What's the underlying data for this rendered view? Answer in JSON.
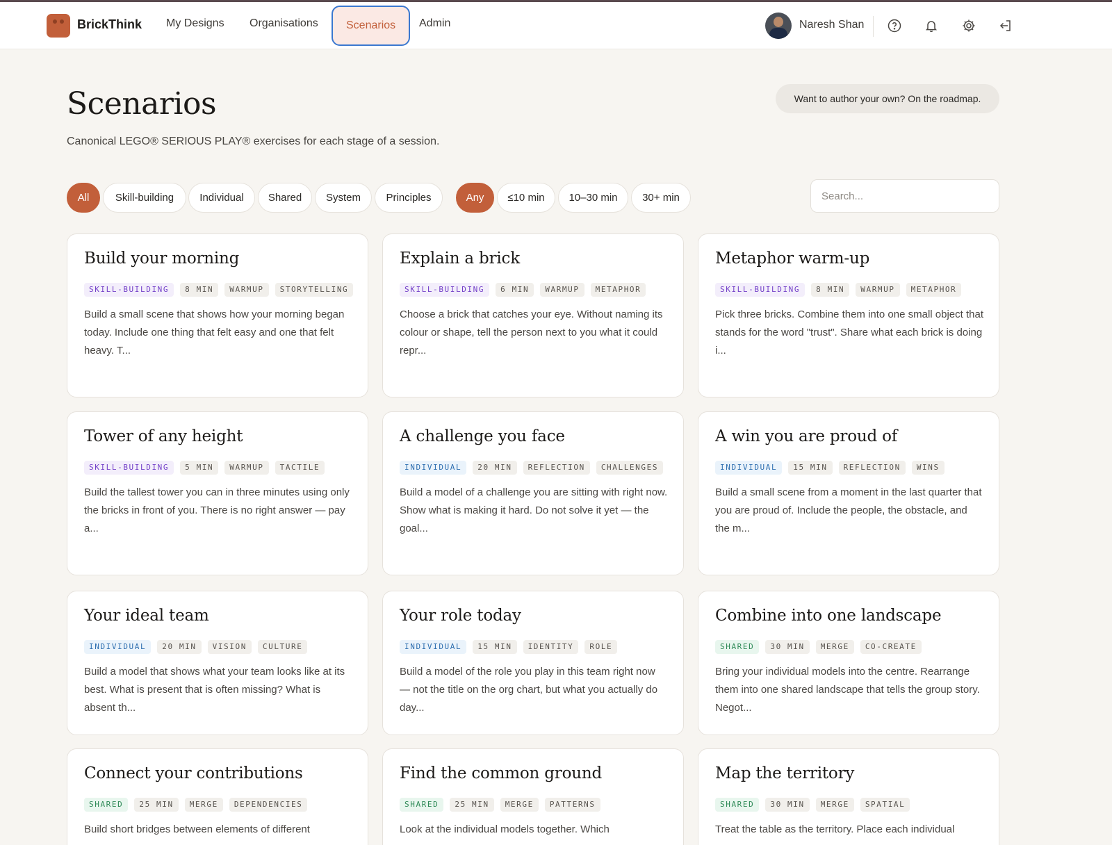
{
  "app": {
    "brand": "BrickThink"
  },
  "nav": [
    {
      "label": "My Designs",
      "active": false
    },
    {
      "label": "Organisations",
      "active": false
    },
    {
      "label": "Scenarios",
      "active": true
    },
    {
      "label": "Admin",
      "active": false
    }
  ],
  "user": {
    "name": "Naresh Shan"
  },
  "header_icons": [
    "help-icon",
    "bell-icon",
    "gear-icon",
    "logout-icon"
  ],
  "page": {
    "title": "Scenarios",
    "subtitle": "Canonical LEGO® SERIOUS PLAY® exercises for each stage of a session.",
    "roadmap_pill": "Want to author your own? On the roadmap."
  },
  "filters": {
    "categories": [
      "All",
      "Skill-building",
      "Individual",
      "Shared",
      "System",
      "Principles"
    ],
    "category_selected": "All",
    "durations": [
      "Any",
      "≤10 min",
      "10–30 min",
      "30+ min"
    ],
    "duration_selected": "Any",
    "search": {
      "placeholder": "Search...",
      "value": ""
    }
  },
  "colors": {
    "accent": "#c25f3a",
    "skill_building": "#7340c8",
    "individual": "#2f6fb0",
    "shared": "#2e8a57",
    "focus_ring": "#3a78d0"
  },
  "cards": [
    {
      "title": "Build your morning",
      "tags": [
        "SKILL-BUILDING",
        "8 MIN",
        "WARMUP",
        "STORYTELLING"
      ],
      "description": "Build a small scene that shows how your morning began today. Include one thing that felt easy and one that felt heavy. T..."
    },
    {
      "title": "Explain a brick",
      "tags": [
        "SKILL-BUILDING",
        "6 MIN",
        "WARMUP",
        "METAPHOR"
      ],
      "description": "Choose a brick that catches your eye. Without naming its colour or shape, tell the person next to you what it could repr..."
    },
    {
      "title": "Metaphor warm-up",
      "tags": [
        "SKILL-BUILDING",
        "8 MIN",
        "WARMUP",
        "METAPHOR"
      ],
      "description": "Pick three bricks. Combine them into one small object that stands for the word \"trust\". Share what each brick is doing i..."
    },
    {
      "title": "Tower of any height",
      "tags": [
        "SKILL-BUILDING",
        "5 MIN",
        "WARMUP",
        "TACTILE"
      ],
      "description": "Build the tallest tower you can in three minutes using only the bricks in front of you. There is no right answer — pay a..."
    },
    {
      "title": "A challenge you face",
      "tags": [
        "INDIVIDUAL",
        "20 MIN",
        "REFLECTION",
        "CHALLENGES"
      ],
      "description": "Build a model of a challenge you are sitting with right now. Show what is making it hard. Do not solve it yet — the goal..."
    },
    {
      "title": "A win you are proud of",
      "tags": [
        "INDIVIDUAL",
        "15 MIN",
        "REFLECTION",
        "WINS"
      ],
      "description": "Build a small scene from a moment in the last quarter that you are proud of. Include the people, the obstacle, and the m..."
    },
    {
      "title": "Your ideal team",
      "tags": [
        "INDIVIDUAL",
        "20 MIN",
        "VISION",
        "CULTURE"
      ],
      "description": "Build a model that shows what your team looks like at its best. What is present that is often missing? What is absent th..."
    },
    {
      "title": "Your role today",
      "tags": [
        "INDIVIDUAL",
        "15 MIN",
        "IDENTITY",
        "ROLE"
      ],
      "description": "Build a model of the role you play in this team right now — not the title on the org chart, but what you actually do day..."
    },
    {
      "title": "Combine into one landscape",
      "tags": [
        "SHARED",
        "30 MIN",
        "MERGE",
        "CO-CREATE"
      ],
      "description": "Bring your individual models into the centre. Rearrange them into one shared landscape that tells the group story. Negot..."
    },
    {
      "title": "Connect your contributions",
      "tags": [
        "SHARED",
        "25 MIN",
        "MERGE",
        "DEPENDENCIES"
      ],
      "description": "Build short bridges between elements of different"
    },
    {
      "title": "Find the common ground",
      "tags": [
        "SHARED",
        "25 MIN",
        "MERGE",
        "PATTERNS"
      ],
      "description": "Look at the individual models together. Which"
    },
    {
      "title": "Map the territory",
      "tags": [
        "SHARED",
        "30 MIN",
        "MERGE",
        "SPATIAL"
      ],
      "description": "Treat the table as the territory. Place each individual"
    }
  ]
}
